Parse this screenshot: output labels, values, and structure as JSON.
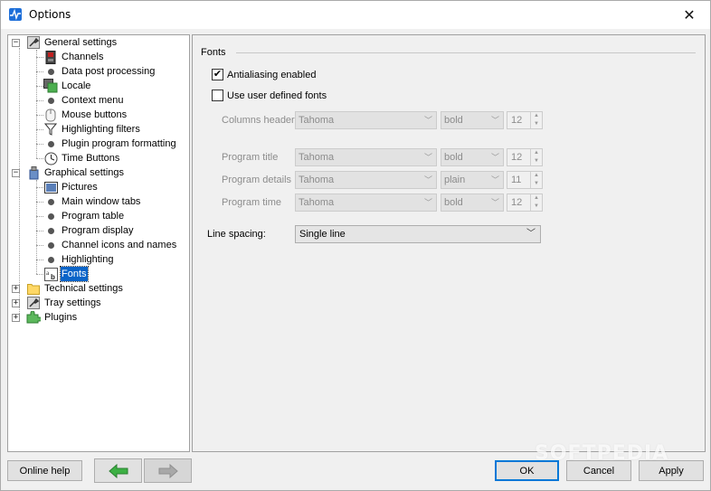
{
  "window": {
    "title": "Options",
    "close_glyph": "✕"
  },
  "tree": {
    "items": [
      {
        "label": "General settings",
        "icon": "wrench-icon"
      },
      {
        "label": "Channels",
        "icon": "channel-icon"
      },
      {
        "label": "Data post processing",
        "icon": "dot-icon"
      },
      {
        "label": "Locale",
        "icon": "locale-icon"
      },
      {
        "label": "Context menu",
        "icon": "dot-icon"
      },
      {
        "label": "Mouse buttons",
        "icon": "mouse-icon"
      },
      {
        "label": "Highlighting filters",
        "icon": "filter-icon"
      },
      {
        "label": "Plugin program formatting",
        "icon": "dot-icon"
      },
      {
        "label": "Time Buttons",
        "icon": "clock-icon"
      },
      {
        "label": "Graphical settings",
        "icon": "paint-icon"
      },
      {
        "label": "Pictures",
        "icon": "picture-icon"
      },
      {
        "label": "Main window tabs",
        "icon": "dot-icon"
      },
      {
        "label": "Program table",
        "icon": "dot-icon"
      },
      {
        "label": "Program display",
        "icon": "dot-icon"
      },
      {
        "label": "Channel icons and names",
        "icon": "dot-icon"
      },
      {
        "label": "Highlighting",
        "icon": "dot-icon"
      },
      {
        "label": "Fonts",
        "icon": "font-icon"
      },
      {
        "label": "Technical settings",
        "icon": "folder-icon"
      },
      {
        "label": "Tray settings",
        "icon": "wrench-icon"
      },
      {
        "label": "Plugins",
        "icon": "puzzle-icon"
      }
    ]
  },
  "fonts": {
    "section_title": "Fonts",
    "antialiasing_label": "Antialiasing enabled",
    "antialiasing_checked": true,
    "user_fonts_label": "Use user defined fonts",
    "user_fonts_checked": false,
    "rows": [
      {
        "label": "Columns header",
        "family": "Tahoma",
        "style": "bold",
        "size": "12"
      },
      {
        "label": "Program title",
        "family": "Tahoma",
        "style": "bold",
        "size": "12"
      },
      {
        "label": "Program details",
        "family": "Tahoma",
        "style": "plain",
        "size": "11"
      },
      {
        "label": "Program time",
        "family": "Tahoma",
        "style": "bold",
        "size": "12"
      }
    ],
    "line_spacing_label": "Line spacing:",
    "line_spacing_value": "Single line"
  },
  "buttons": {
    "online_help": "Online help",
    "ok": "OK",
    "cancel": "Cancel",
    "apply": "Apply"
  },
  "colors": {
    "selection": "#0a64c8",
    "nav_arrow_active": "#3cb043",
    "nav_arrow_inactive": "#a8a8a8"
  },
  "watermark": "SOFTPEDIA"
}
